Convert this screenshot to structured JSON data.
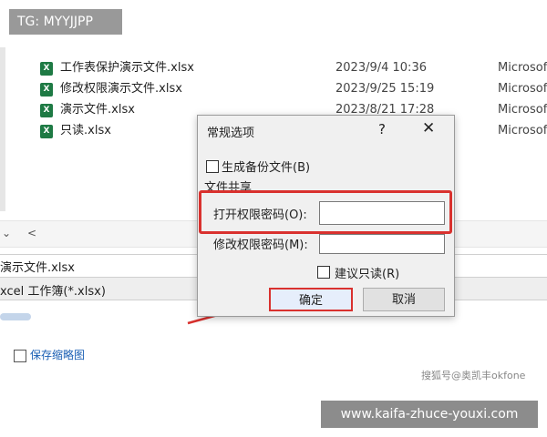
{
  "watermarks": {
    "top": "TG: MYYJJPP",
    "bottom": "www.kaifa-zhuce-youxi.com"
  },
  "files": [
    {
      "name": "工作表保护演示文件.xlsx",
      "date": "2023/9/4 10:36",
      "type": "Microsof"
    },
    {
      "name": "修改权限演示文件.xlsx",
      "date": "2023/9/25 15:19",
      "type": "Microsof"
    },
    {
      "name": "演示文件.xlsx",
      "date": "2023/8/21 17:28",
      "type": "Microsof"
    },
    {
      "name": "只读.xlsx",
      "date": "",
      "type": "Microsof"
    }
  ],
  "icons": {
    "excel": "X"
  },
  "scroll": {
    "left_arrow": "<",
    "down_arrow": "⌄"
  },
  "save_form": {
    "filename_value": "演示文件.xlsx",
    "filetype_value": "xcel 工作簿(*.xlsx)",
    "thumbnail_label": "保存缩略图"
  },
  "credit": "搜狐号@奥凯丰okfone",
  "dialog": {
    "title": "常规选项",
    "help": "?",
    "close": "✕",
    "backup_label": "生成备份文件(B)",
    "share_section": "文件共享",
    "open_password_label": "打开权限密码(O):",
    "modify_password_label": "修改权限密码(M):",
    "readonly_label": "建议只读(R)",
    "ok_label": "确定",
    "cancel_label": "取消"
  },
  "colors": {
    "highlight": "#d9312e",
    "excel_green": "#1e7a44"
  }
}
